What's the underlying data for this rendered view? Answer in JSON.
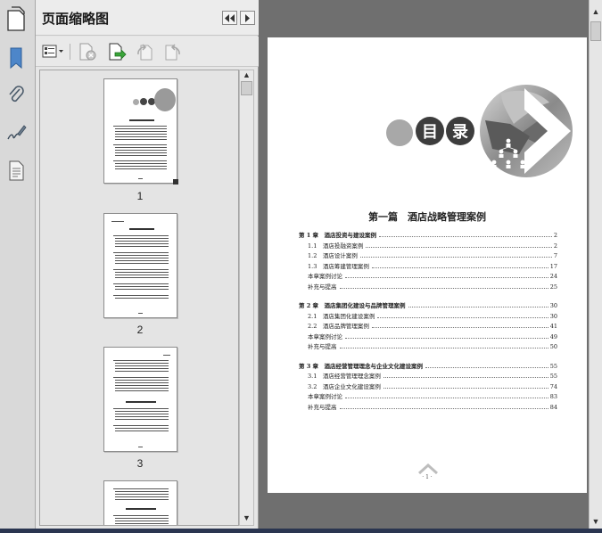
{
  "panel": {
    "title": "页面缩略图"
  },
  "thumbnails": [
    {
      "label": "1"
    },
    {
      "label": "2"
    },
    {
      "label": "3"
    }
  ],
  "document": {
    "toc_heading": [
      "目",
      "录"
    ],
    "part_title": "第一篇　酒店战略管理案例",
    "toc": [
      {
        "label": "第 1 章　酒店投资与建设案例",
        "page": "2",
        "level": 0
      },
      {
        "label": "1.1　酒店投融资案例",
        "page": "2",
        "level": 1
      },
      {
        "label": "1.2　酒店设计案例",
        "page": "7",
        "level": 1
      },
      {
        "label": "1.3　酒店筹建管理案例",
        "page": "17",
        "level": 1
      },
      {
        "label": "本章案例讨论",
        "page": "24",
        "level": 1
      },
      {
        "label": "补充与提高",
        "page": "25",
        "level": 1
      },
      {
        "label": "第 2 章　酒店集团化建设与品牌管理案例",
        "page": "30",
        "level": 0
      },
      {
        "label": "2.1　酒店集团化建设案例",
        "page": "30",
        "level": 1
      },
      {
        "label": "2.2　酒店品牌管理案例",
        "page": "41",
        "level": 1
      },
      {
        "label": "本章案例讨论",
        "page": "49",
        "level": 1
      },
      {
        "label": "补充与提高",
        "page": "50",
        "level": 1
      },
      {
        "label": "第 3 章　酒店经营管理理念与企业文化建设案例",
        "page": "55",
        "level": 0
      },
      {
        "label": "3.1　酒店经营管理理念案例",
        "page": "55",
        "level": 1
      },
      {
        "label": "3.2　酒店企业文化建设案例",
        "page": "74",
        "level": 1
      },
      {
        "label": "本章案例讨论",
        "page": "83",
        "level": 1
      },
      {
        "label": "补充与提高",
        "page": "84",
        "level": 1
      }
    ],
    "page_number": "· 1 ·"
  },
  "icons": {
    "rail": [
      "pages-icon",
      "bookmark-icon",
      "attachment-icon",
      "signature-icon",
      "document-properties-icon"
    ],
    "toolbar": [
      "thumbnail-options-icon",
      "delete-page-icon",
      "insert-page-icon",
      "rotate-left-icon",
      "rotate-right-icon"
    ]
  },
  "colors": {
    "accent": "#3a7bd5",
    "circle_dark": "#3d3d3d",
    "circle_light": "#a8a8a8"
  }
}
